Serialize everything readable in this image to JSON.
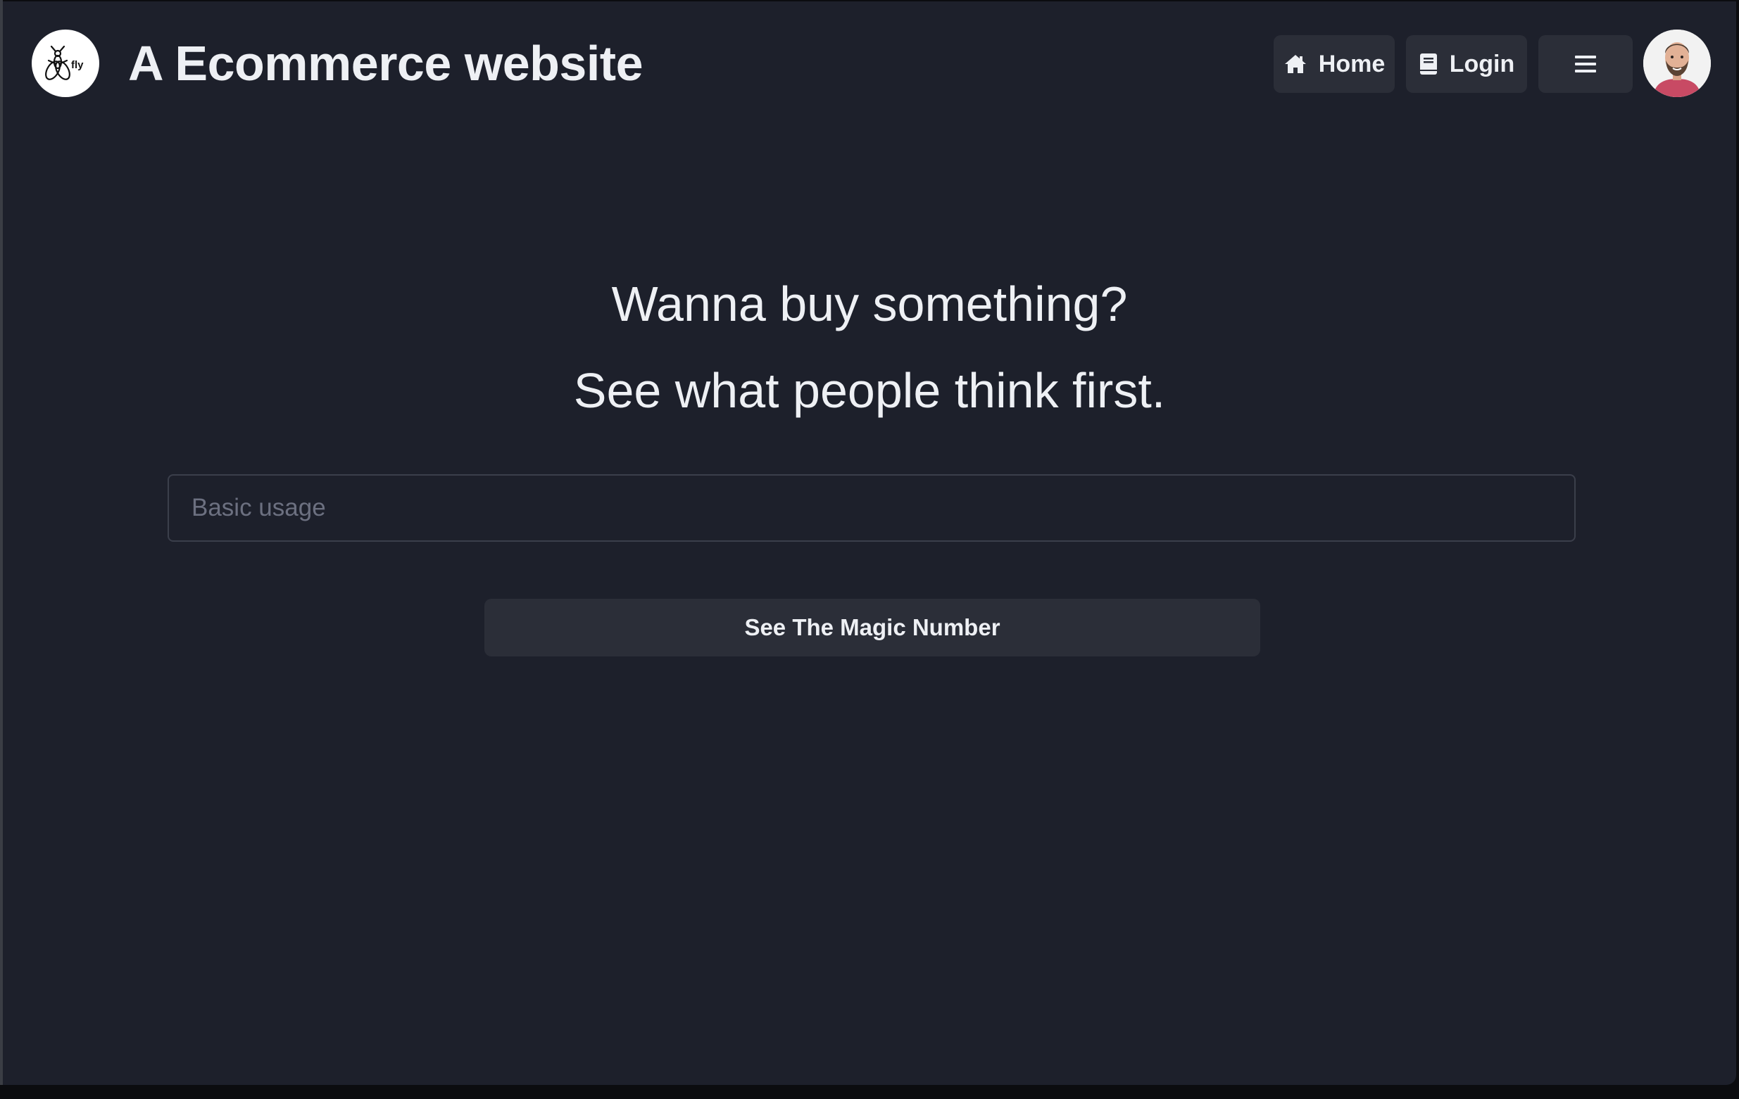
{
  "navbar": {
    "logo_text": "fly",
    "title": "A Ecommerce website",
    "home_label": "Home",
    "login_label": "Login",
    "menu_icon": "hamburger-menu-icon",
    "home_icon": "home-icon",
    "login_icon": "book-icon",
    "avatar": "user-avatar"
  },
  "hero": {
    "line1": "Wanna buy something?",
    "line2": "See what people think first."
  },
  "search": {
    "placeholder": "Basic usage",
    "value": ""
  },
  "action": {
    "label": "See The Magic Number"
  },
  "colors": {
    "background": "#1d202b",
    "button": "#2b2e38",
    "text": "#eef0f4",
    "border": "#3b3f4b",
    "avatar_shirt": "#c84a64"
  }
}
